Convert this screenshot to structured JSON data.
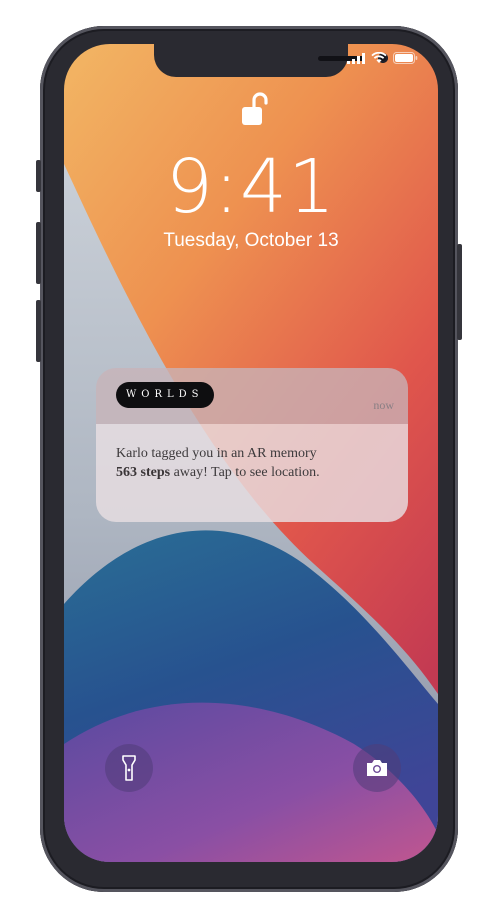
{
  "lockscreen": {
    "time": "9:41",
    "date": "Tuesday, October 13"
  },
  "notification": {
    "app_name": "WORLDS",
    "timestamp": "now",
    "message_part1": "Karlo tagged you in an AR memory",
    "message_bold": "563 steps",
    "message_part2": " away! Tap to see location."
  },
  "icons": {
    "lock": "unlocked-padlock-icon",
    "flashlight": "flashlight-icon",
    "camera": "camera-icon"
  }
}
